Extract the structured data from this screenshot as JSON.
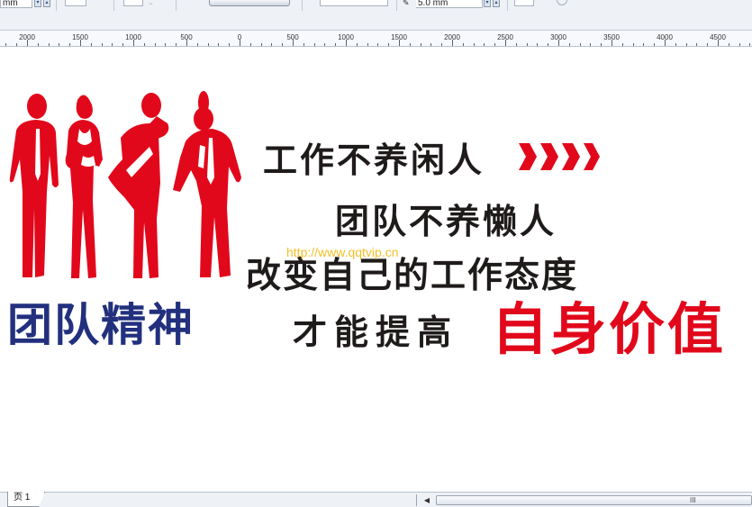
{
  "propbar": {
    "unit_left": "mm",
    "outline_width": "5.0 mm"
  },
  "ruler": {
    "labels": [
      "2000",
      "1500",
      "1000",
      "500",
      "0",
      "500",
      "1000",
      "1500",
      "2000",
      "2500",
      "3000",
      "3500",
      "4000",
      "4500"
    ]
  },
  "artwork": {
    "team_spirit": "团队精神",
    "line1": "工作不养闲人",
    "line2": "团队不养懒人",
    "line3": "改变自己的工作态度",
    "line4": "才能提高",
    "line4_highlight": "自身价值",
    "watermark": "http://www.qqtvip.cn",
    "silhouette_color": "#e2081b",
    "title_color": "#22307e",
    "text_color": "#1f1b1b",
    "highlight_color": "#e2081b"
  },
  "status": {
    "page_tab": "页 1",
    "scroll_grip": "III"
  }
}
